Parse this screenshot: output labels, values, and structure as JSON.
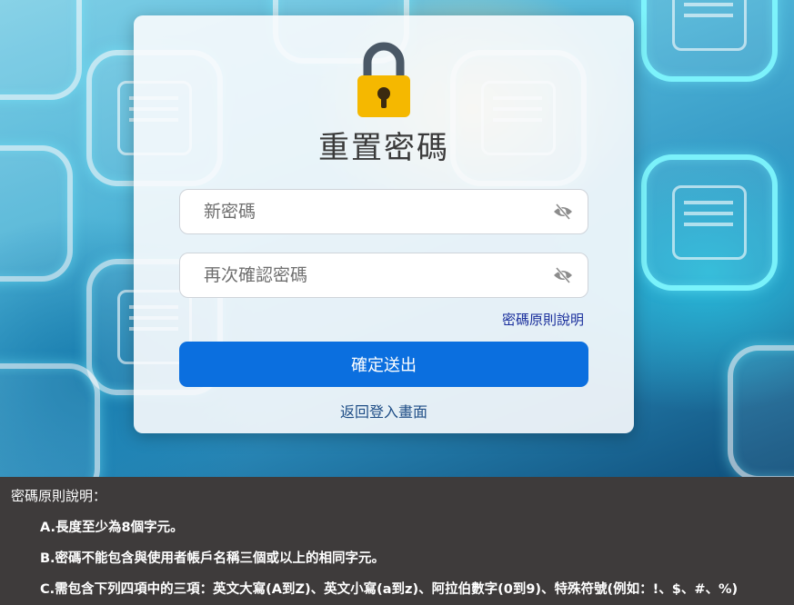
{
  "form": {
    "title": "重置密碼",
    "new_password_placeholder": "新密碼",
    "confirm_password_placeholder": "再次確認密碼",
    "rules_link": "密碼原則說明",
    "submit_label": "確定送出",
    "back_link": "返回登入畫面"
  },
  "rules": {
    "title": "密碼原則說明：",
    "items": [
      "A.長度至少為8個字元。",
      "B.密碼不能包含與使用者帳戶名稱三個或以上的相同字元。",
      "C.需包含下列四項中的三項：英文大寫(A到Z)、英文小寫(a到z)、阿拉伯數字(0到9)、特殊符號(例如：!、$、#、%)"
    ]
  },
  "icons": {
    "lock": "lock-icon",
    "eye": "eye-slash-icon"
  },
  "colors": {
    "primary_button": "#0b6fdf",
    "lock_body": "#f5b800",
    "rules_background": "#3e3b3b"
  }
}
